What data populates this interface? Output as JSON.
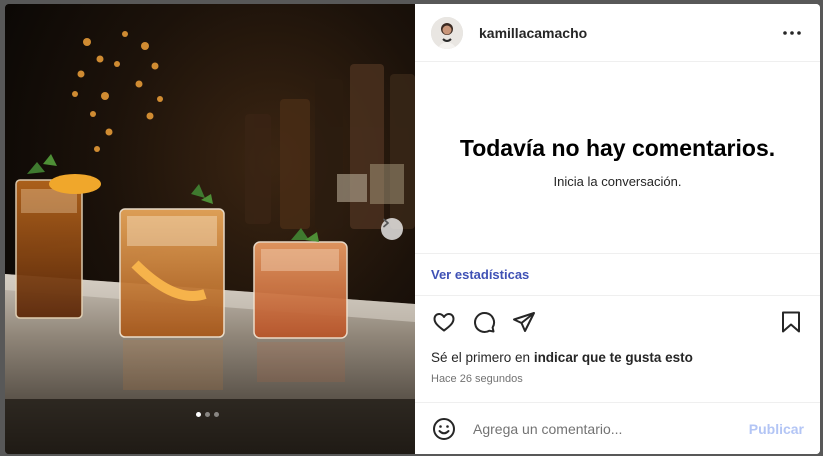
{
  "post": {
    "username": "kamillacamacho",
    "more_icon": "more-horizontal-icon",
    "carousel": {
      "total_slides": 3,
      "active_slide": 1,
      "next_icon": "chevron-right-icon"
    }
  },
  "comments": {
    "empty_title": "Todavía no hay comentarios.",
    "empty_subtitle": "Inicia la conversación."
  },
  "stats_link": "Ver estadísticas",
  "actions": {
    "like_icon": "heart-icon",
    "comment_icon": "comment-icon",
    "share_icon": "share-icon",
    "save_icon": "bookmark-icon"
  },
  "likes": {
    "prefix": "Sé el primero en ",
    "link": "indicar que te gusta esto"
  },
  "timestamp": "Hace 26 segundos",
  "composer": {
    "placeholder": "Agrega un comentario...",
    "publish_label": "Publicar",
    "emoji_icon": "emoji-icon"
  },
  "colors": {
    "link_blue": "#3f51b5",
    "publish_disabled": "#b3c5f5",
    "overlay": "#585858"
  }
}
